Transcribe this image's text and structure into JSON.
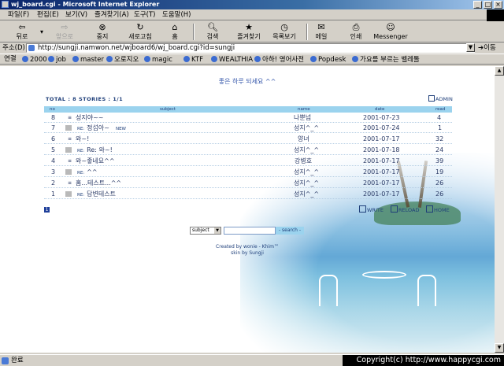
{
  "window": {
    "title": "wj_board.cgi - Microsoft Internet Explorer",
    "min": "_",
    "max": "□",
    "close": "×"
  },
  "menu": [
    "파일(F)",
    "편집(E)",
    "보기(V)",
    "즐겨찾기(A)",
    "도구(T)",
    "도움말(H)"
  ],
  "toolbar": {
    "back": "뒤로",
    "forward": "앞으로",
    "stop": "중지",
    "refresh": "새로고침",
    "home": "홈",
    "search": "검색",
    "favorites": "즐겨찾기",
    "history": "목록보기",
    "mail": "메일",
    "print": "인쇄",
    "messenger": "Messenger"
  },
  "address": {
    "label": "주소(D)",
    "url": "http://sungji.namwon.net/wjboard6/wj_board.cgi?id=sungji",
    "go": "이동"
  },
  "links": {
    "lead": "연결",
    "items": [
      "2000",
      "job",
      "master",
      "오로지오",
      "magic",
      "KTF",
      "WEALTHIA",
      "아하! 영어사전",
      "Popdesk",
      "가요를 부르는 벨레톨"
    ]
  },
  "board": {
    "heading": "좋은 하루 되세요 ^^",
    "total": "TOTAL : 8 STORIES : 1/1",
    "admin": "ADMIN",
    "columns": {
      "no": "no",
      "subject": "subject",
      "name": "name",
      "date": "date",
      "read": "read"
    },
    "rows": [
      {
        "no": "8",
        "subject": "성지야~~",
        "name": "나뿐넘",
        "date": "2001-07-23",
        "read": "4"
      },
      {
        "no": "7",
        "subject": "정섭아~",
        "name": "성지^_^",
        "date": "2001-07-24",
        "read": "1"
      },
      {
        "no": "6",
        "subject": "와~!",
        "name": "양녀",
        "date": "2001-07-17",
        "read": "32"
      },
      {
        "no": "5",
        "subject": "Re: 와~!",
        "name": "성지^_^",
        "date": "2001-07-18",
        "read": "24"
      },
      {
        "no": "4",
        "subject": "와~좋네요^^",
        "name": "강병호",
        "date": "2001-07-17",
        "read": "39"
      },
      {
        "no": "3",
        "subject": "^^",
        "name": "성지^_^",
        "date": "2001-07-17",
        "read": "19"
      },
      {
        "no": "2",
        "subject": "홈...테스트...^^",
        "name": "성지^_^",
        "date": "2001-07-17",
        "read": "26"
      },
      {
        "no": "1",
        "subject": "답변테스트",
        "name": "성지^_^",
        "date": "2001-07-17",
        "read": "26"
      }
    ],
    "re_tag": "RE:",
    "new_tag": "NEW",
    "page": "1",
    "write": "WRITE",
    "reload": "RELOAD",
    "home": "HOME",
    "search_select": "subject",
    "search_button": "- search -",
    "credit1": "Created by wonie - Khim™",
    "credit2": "skin by Sungji"
  },
  "status": {
    "text": "완료"
  },
  "copyright": "Copyright(c) http://www.happycgi.com"
}
